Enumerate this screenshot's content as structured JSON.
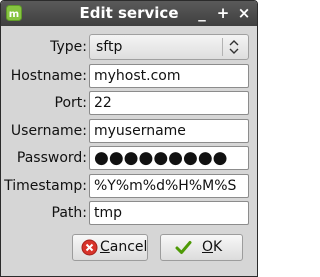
{
  "window": {
    "title": "Edit service",
    "controls": {
      "minimize": "_",
      "maximize": "+",
      "close": "×"
    }
  },
  "form": {
    "type": {
      "label": "Type:",
      "value": "sftp"
    },
    "hostname": {
      "label": "Hostname:",
      "value": "myhost.com"
    },
    "port": {
      "label": "Port:",
      "value": "22"
    },
    "username": {
      "label": "Username:",
      "value": "myusername"
    },
    "password": {
      "label": "Password:",
      "value": "●●●●●●●●●"
    },
    "timestamp": {
      "label": "Timestamp:",
      "value": "%Y%m%d%H%M%S"
    },
    "path": {
      "label": "Path:",
      "value": "tmp"
    }
  },
  "buttons": {
    "cancel": {
      "mnemonic": "C",
      "rest": "ancel"
    },
    "ok": {
      "mnemonic": "O",
      "rest": "K"
    }
  },
  "colors": {
    "titlebar": "#4a4a4a",
    "dialog_bg": "#d6d6d6",
    "app_icon": "#86c440",
    "cancel_icon": "#d8332a",
    "ok_icon": "#4e9a06"
  }
}
